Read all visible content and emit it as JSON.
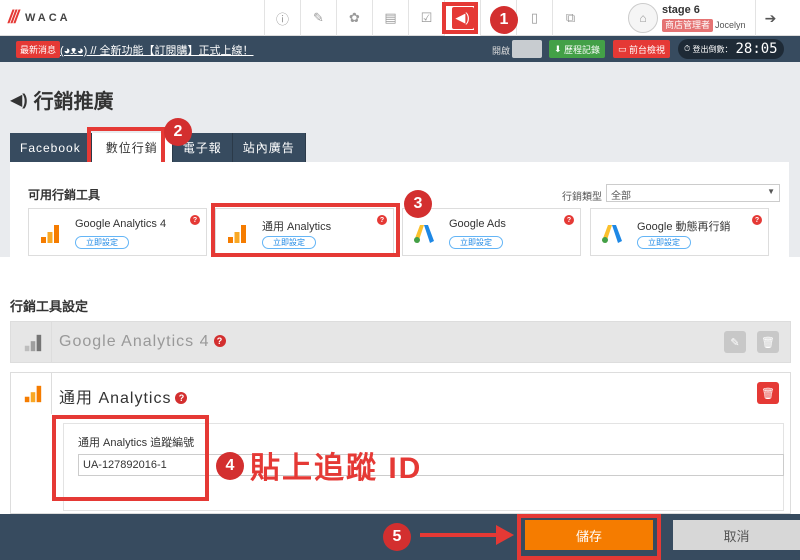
{
  "app": {
    "logo_text": "WACA"
  },
  "topbar": {
    "nav_icons": [
      "info-icon",
      "edit-icon",
      "palette-icon",
      "store-icon",
      "checklist-icon",
      "megaphone-icon",
      "user-icon",
      "document-icon",
      "layers-icon"
    ],
    "user": {
      "stage": "stage 6",
      "role": "商店管理者",
      "name": "Jocelyn"
    }
  },
  "notice": {
    "badge": "最新消息",
    "message": "(◕ᴥ◕) // 全新功能【訂閱購】正式上線！",
    "open_label": "開啟",
    "history_button": "歷程記錄",
    "preview_button": "前台檢視",
    "logout_countdown_label": "登出倒數：",
    "logout_countdown": "28:05"
  },
  "page": {
    "title": "行銷推廣"
  },
  "tabs": [
    "Facebook",
    "數位行銷",
    "電子報",
    "站內廣告"
  ],
  "tools_section": {
    "title": "可用行銷工具",
    "filter_label": "行銷類型",
    "filter_value": "全部",
    "tools": [
      {
        "name": "Google Analytics 4",
        "button": "立即設定",
        "icon": "analytics-icon"
      },
      {
        "name": "通用 Analytics",
        "button": "立即設定",
        "icon": "analytics-icon"
      },
      {
        "name": "Google Ads",
        "button": "立即設定",
        "icon": "google-ads-icon"
      },
      {
        "name": "Google 動態再行銷",
        "button": "立即設定",
        "icon": "google-ads-icon"
      }
    ]
  },
  "settings_section": {
    "title": "行銷工具設定",
    "rows": [
      {
        "name": "Google Analytics 4"
      },
      {
        "name": "通用 Analytics",
        "field_label": "通用 Analytics 追蹤編號",
        "field_value": "UA-127892016-1"
      }
    ]
  },
  "annotations": {
    "steps": [
      "1",
      "2",
      "3",
      "4",
      "5"
    ],
    "paste_label": "貼上追蹤 ID"
  },
  "footer": {
    "save": "儲存",
    "cancel": "取消"
  },
  "colors": {
    "navy": "#374b5f",
    "accent_red": "#e53935",
    "save_orange": "#f57c00"
  }
}
